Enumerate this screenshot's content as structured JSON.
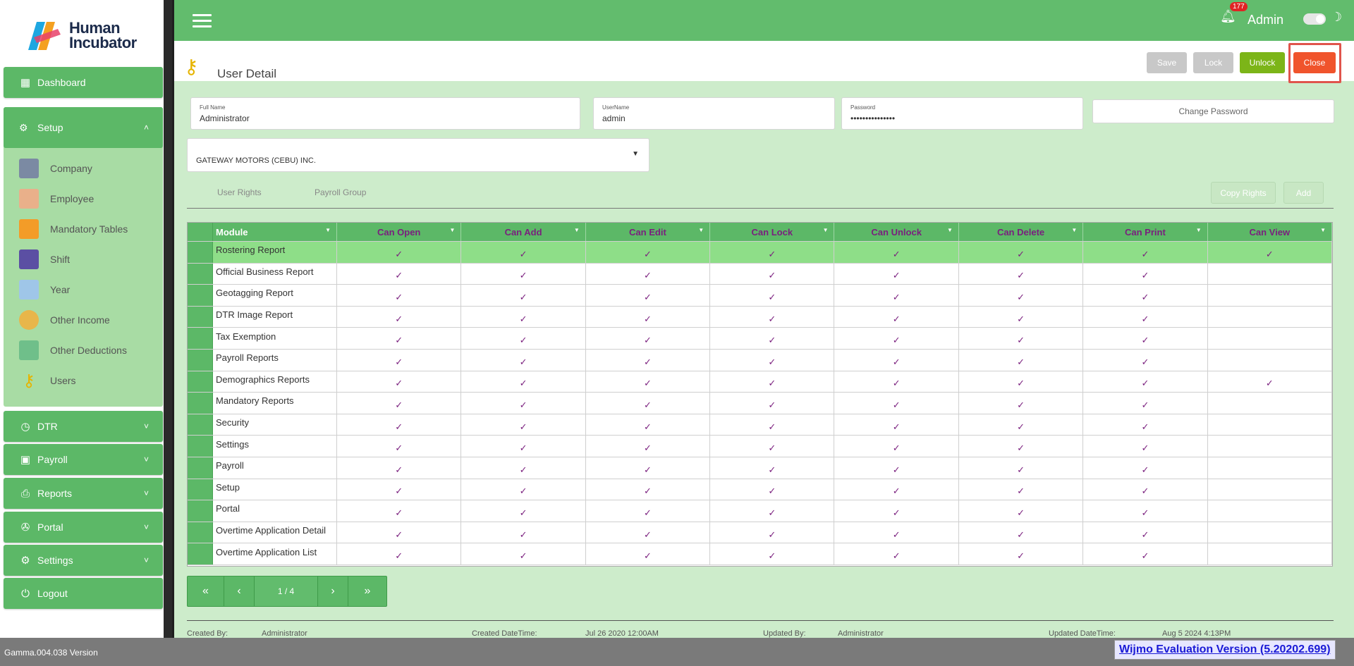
{
  "app": {
    "logo_line1": "Human",
    "logo_line2": "Incubator",
    "version": "Gamma.004.038 Version",
    "wijmo_notice": "Wijmo Evaluation Version (5.20202.699)"
  },
  "sidebar": {
    "dashboard": "Dashboard",
    "setup": "Setup",
    "setup_items": [
      "Company",
      "Employee",
      "Mandatory Tables",
      "Shift",
      "Year",
      "Other Income",
      "Other Deductions",
      "Users"
    ],
    "dtr": "DTR",
    "payroll": "Payroll",
    "reports": "Reports",
    "portal": "Portal",
    "settings": "Settings",
    "logout": "Logout"
  },
  "topbar": {
    "notification_count": "177",
    "user": "Admin"
  },
  "page": {
    "title": "User Detail",
    "buttons": {
      "save": "Save",
      "lock": "Lock",
      "unlock": "Unlock",
      "close": "Close"
    }
  },
  "form": {
    "full_name_label": "Full Name",
    "full_name": "Administrator",
    "username_label": "UserName",
    "username": "admin",
    "password_label": "Password",
    "password": "•••••••••••••••",
    "change_password": "Change Password",
    "company": "GATEWAY MOTORS (CEBU) INC."
  },
  "tabs": {
    "user_rights": "User Rights",
    "payroll_group": "Payroll Group",
    "copy_rights": "Copy Rights",
    "add": "Add"
  },
  "grid": {
    "columns": [
      "Module",
      "Can Open",
      "Can Add",
      "Can Edit",
      "Can Lock",
      "Can Unlock",
      "Can Delete",
      "Can Print",
      "Can View"
    ],
    "check_glyph": "✓",
    "rows": [
      {
        "module": "Rostering Report",
        "perms": [
          1,
          1,
          1,
          1,
          1,
          1,
          1,
          1
        ]
      },
      {
        "module": "Official Business Report",
        "perms": [
          1,
          1,
          1,
          1,
          1,
          1,
          1,
          0
        ]
      },
      {
        "module": "Geotagging Report",
        "perms": [
          1,
          1,
          1,
          1,
          1,
          1,
          1,
          0
        ]
      },
      {
        "module": "DTR Image Report",
        "perms": [
          1,
          1,
          1,
          1,
          1,
          1,
          1,
          0
        ]
      },
      {
        "module": "Tax Exemption",
        "perms": [
          1,
          1,
          1,
          1,
          1,
          1,
          1,
          0
        ]
      },
      {
        "module": "Payroll Reports",
        "perms": [
          1,
          1,
          1,
          1,
          1,
          1,
          1,
          0
        ]
      },
      {
        "module": "Demographics Reports",
        "perms": [
          1,
          1,
          1,
          1,
          1,
          1,
          1,
          1
        ]
      },
      {
        "module": "Mandatory Reports",
        "perms": [
          1,
          1,
          1,
          1,
          1,
          1,
          1,
          0
        ]
      },
      {
        "module": "Security",
        "perms": [
          1,
          1,
          1,
          1,
          1,
          1,
          1,
          0
        ]
      },
      {
        "module": "Settings",
        "perms": [
          1,
          1,
          1,
          1,
          1,
          1,
          1,
          0
        ]
      },
      {
        "module": "Payroll",
        "perms": [
          1,
          1,
          1,
          1,
          1,
          1,
          1,
          0
        ]
      },
      {
        "module": "Setup",
        "perms": [
          1,
          1,
          1,
          1,
          1,
          1,
          1,
          0
        ]
      },
      {
        "module": "Portal",
        "perms": [
          1,
          1,
          1,
          1,
          1,
          1,
          1,
          0
        ]
      },
      {
        "module": "Overtime Application Detail",
        "perms": [
          1,
          1,
          1,
          1,
          1,
          1,
          1,
          0
        ]
      },
      {
        "module": "Overtime Application List",
        "perms": [
          1,
          1,
          1,
          1,
          1,
          1,
          1,
          0
        ]
      }
    ]
  },
  "pager": {
    "first": "«",
    "prev": "‹",
    "info": "1 / 4",
    "next": "›",
    "last": "»"
  },
  "audit": {
    "created_by_label": "Created By:",
    "created_by": "Administrator",
    "created_dt_label": "Created DateTime:",
    "created_dt": "Jul 26 2020 12:00AM",
    "updated_by_label": "Updated By:",
    "updated_by": "Administrator",
    "updated_dt_label": "Updated DateTime:",
    "updated_dt": "Aug 5 2024 4:13PM"
  },
  "colors": {
    "primary_green": "#5cb867",
    "page_bg": "#cdeccb",
    "unlock_button": "#7cb518",
    "close_button": "#f0542c",
    "disabled_button": "#c8c8c8",
    "check_color": "#7a1f7e"
  }
}
